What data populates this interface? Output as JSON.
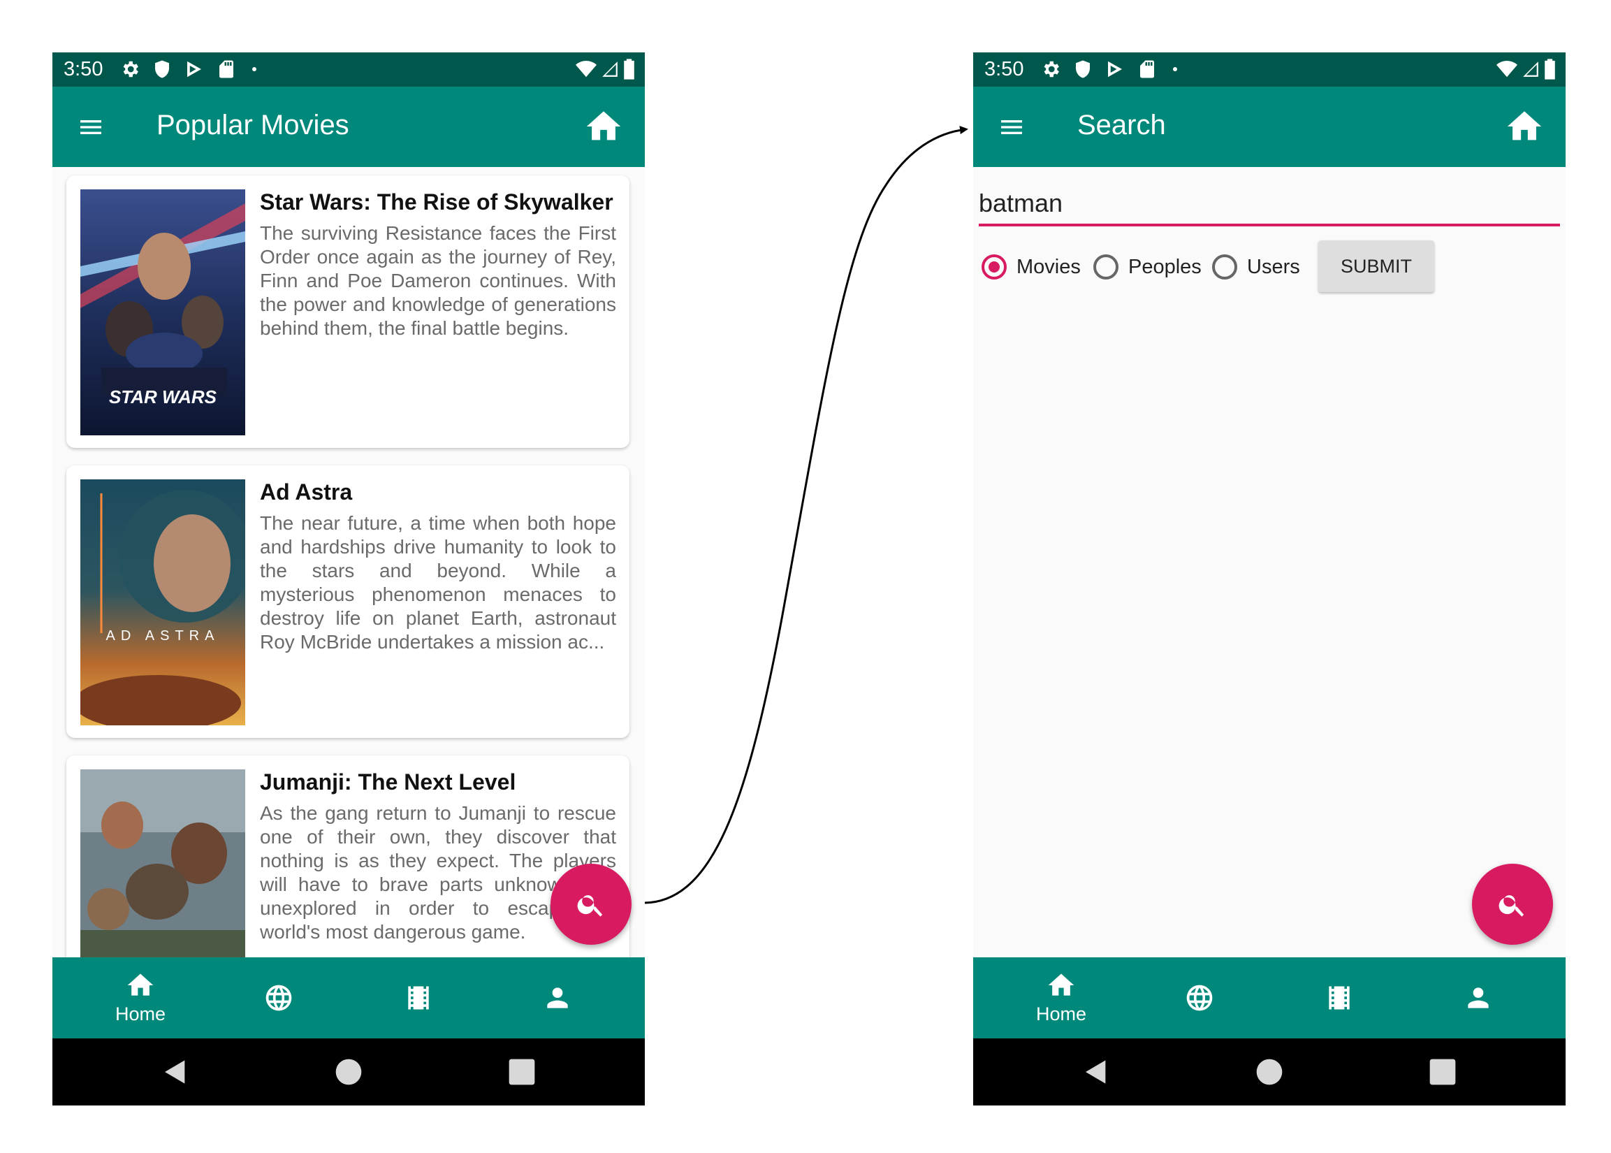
{
  "left_screen": {
    "status_time": "3:50",
    "title": "Popular Movies",
    "movies": [
      {
        "title": "Star Wars: The Rise of Skywalker",
        "overview": "The surviving Resistance faces the First Order once again as the journey of Rey, Finn and Poe Dameron continues. With the power and knowledge of generations behind them, the final battle begins.",
        "poster_text": "STAR WARS"
      },
      {
        "title": "Ad Astra",
        "overview": "The near future, a time when both hope and hardships drive humanity to look to the stars and beyond. While a mysterious phenomenon menaces to destroy life on planet Earth, astronaut Roy McBride undertakes a mission ac...",
        "poster_text": "AD ASTRA"
      },
      {
        "title": "Jumanji: The Next Level",
        "overview": "As the gang return to Jumanji to rescue one of their own, they discover that nothing is as they expect. The players will have to brave parts unknown and unexplored in order to escape the world's most dangerous game."
      }
    ],
    "bottom_nav": {
      "home_label": "Home"
    }
  },
  "right_screen": {
    "status_time": "3:50",
    "title": "Search",
    "search_value": "batman",
    "options": [
      "Movies",
      "Peoples",
      "Users"
    ],
    "selected_option": "Movies",
    "submit_label": "SUBMIT",
    "bottom_nav": {
      "home_label": "Home"
    }
  },
  "colors": {
    "status_bar": "#00574b",
    "app_bar": "#00897b",
    "accent": "#d81b60",
    "system_nav": "#000000"
  },
  "icons": [
    "menu-icon",
    "home-icon",
    "search-icon",
    "globe-icon",
    "film-icon",
    "person-icon",
    "settings-icon",
    "shield-icon",
    "play-store-icon",
    "sd-card-icon",
    "wifi-icon",
    "signal-icon",
    "battery-icon",
    "back-icon",
    "circle-home-icon",
    "recents-icon"
  ]
}
